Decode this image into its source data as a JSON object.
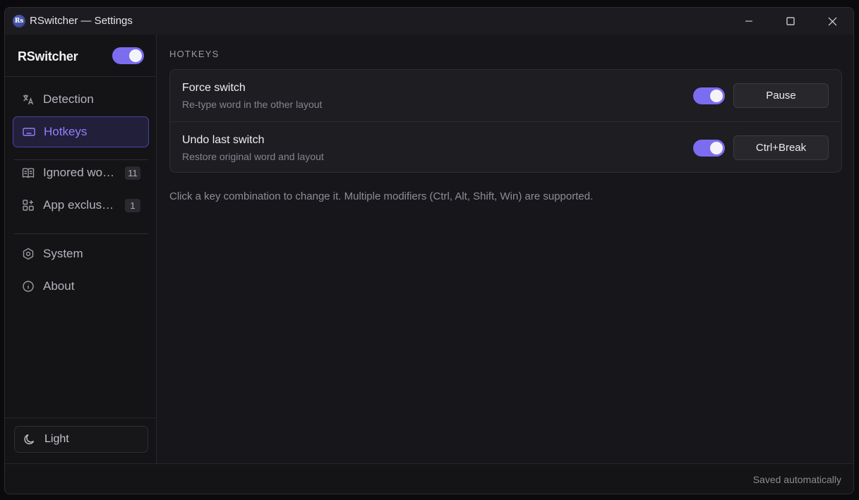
{
  "window": {
    "app_icon_text": "Rs",
    "title": "RSwitcher — Settings"
  },
  "sidebar": {
    "brand": "RSwitcher",
    "enabled": true,
    "items": [
      {
        "label": "Detection",
        "icon": "translate-icon",
        "active": false
      },
      {
        "label": "Hotkeys",
        "icon": "keyboard-icon",
        "active": true
      },
      {
        "label": "Ignored words",
        "icon": "book-icon",
        "badge": "11"
      },
      {
        "label": "App exclusions",
        "icon": "apps-grid-icon",
        "badge": "1"
      },
      {
        "label": "System",
        "icon": "hexagon-gear-icon"
      },
      {
        "label": "About",
        "icon": "info-icon"
      }
    ],
    "theme_button": {
      "label": "Light",
      "icon": "moon-icon"
    }
  },
  "main": {
    "section_title": "HOTKEYS",
    "rows": [
      {
        "title": "Force switch",
        "description": "Re-type word in the other layout",
        "enabled": true,
        "key": "Pause"
      },
      {
        "title": "Undo last switch",
        "description": "Restore original word and layout",
        "enabled": true,
        "key": "Ctrl+Break"
      }
    ],
    "hint": "Click a key combination to change it. Multiple modifiers (Ctrl, Alt, Shift, Win) are supported."
  },
  "status": {
    "text": "Saved automatically"
  },
  "colors": {
    "accent": "#7c6cf0",
    "active_text": "#8f80ff",
    "background": "#17171b"
  }
}
